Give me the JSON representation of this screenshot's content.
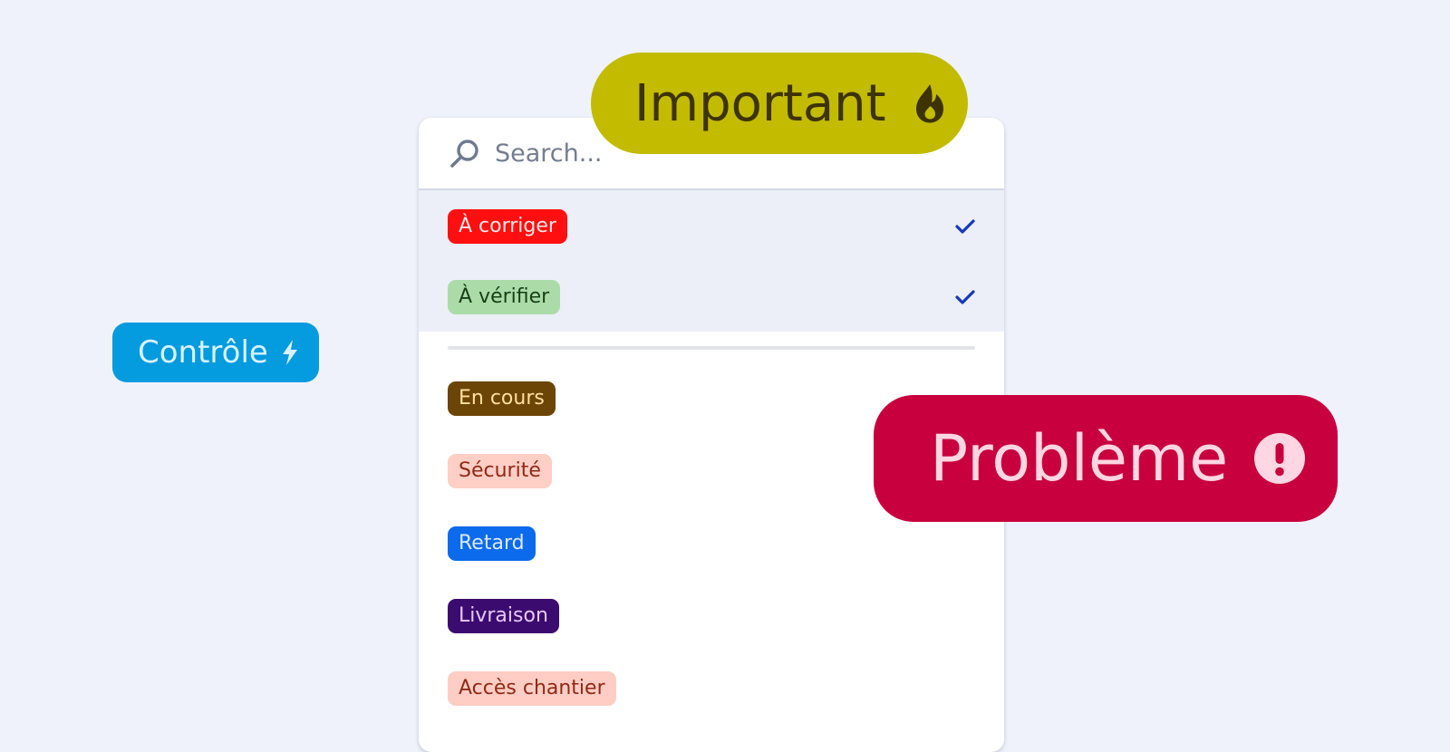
{
  "search": {
    "placeholder": "Search...",
    "value": ""
  },
  "selected_options": [
    {
      "label": "À corriger",
      "bg": "#ff0f0f",
      "fg": "#ffe6e6",
      "checked": true
    },
    {
      "label": "À vérifier",
      "bg": "#abdca8",
      "fg": "#173f16",
      "checked": true
    }
  ],
  "options": [
    {
      "label": "En cours",
      "bg": "#6b4506",
      "fg": "#ffdfa0"
    },
    {
      "label": "Sécurité",
      "bg": "#ffcec5",
      "fg": "#8f2a17"
    },
    {
      "label": "Retard",
      "bg": "#0b6bec",
      "fg": "#dbe9ff"
    },
    {
      "label": "Livraison",
      "bg": "#3c0b6f",
      "fg": "#e6c8ff"
    },
    {
      "label": "Accès chantier",
      "bg": "#ffcdc4",
      "fg": "#8f2a17"
    }
  ],
  "floating_tags": {
    "important": {
      "label": "Important",
      "icon": "flame-icon",
      "bg": "#c2bb00",
      "fg": "#3d3300"
    },
    "controle": {
      "label": "Contrôle",
      "icon": "lightning-icon",
      "bg": "#049bdf",
      "fg": "#d8f3ff"
    },
    "probleme": {
      "label": "Problème",
      "icon": "exclamation-circle-icon",
      "bg": "#c8003e",
      "fg": "#ffd6e2"
    }
  },
  "colors": {
    "background": "#eff2fa",
    "check": "#1738b8",
    "selected_row_bg": "#eceef8"
  }
}
